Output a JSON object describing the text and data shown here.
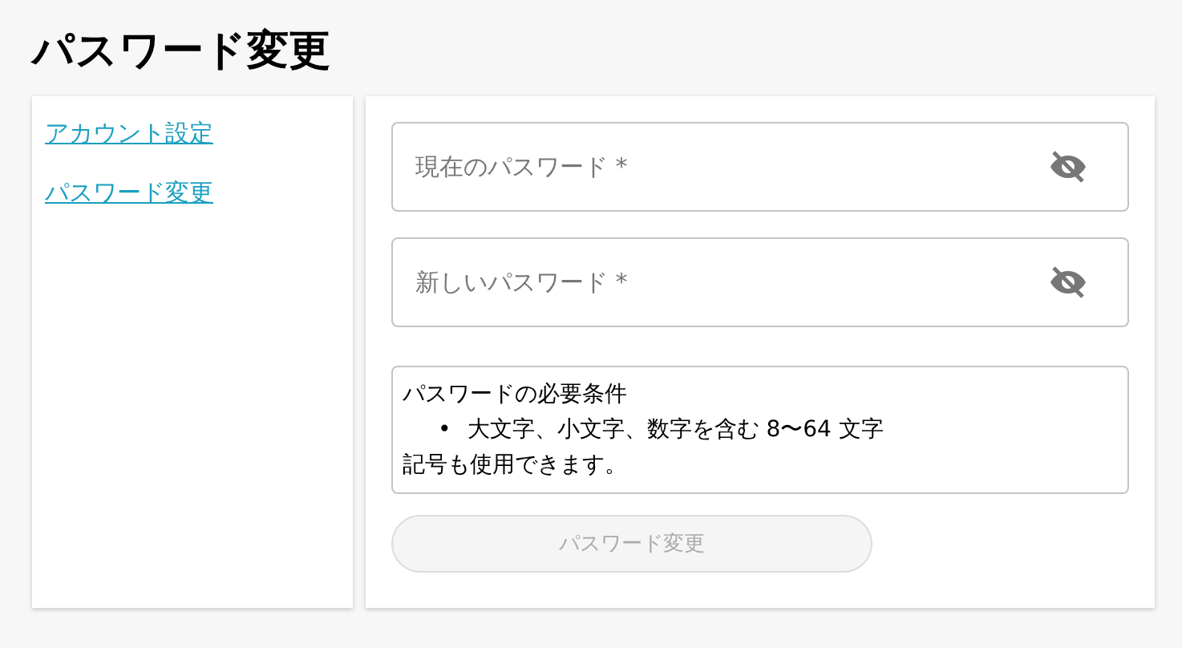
{
  "title": "パスワード変更",
  "sidebar": {
    "items": [
      {
        "label": "アカウント設定"
      },
      {
        "label": "パスワード変更"
      }
    ]
  },
  "fields": [
    {
      "placeholder": "現在のパスワード *",
      "visible": false
    },
    {
      "placeholder": "新しいパスワード *",
      "visible": false
    }
  ],
  "requirements": {
    "heading": "パスワードの必要条件",
    "bullet": "•",
    "items": [
      "大文字、小文字、数字を含む 8〜64 文字"
    ],
    "note": "記号も使用できます。"
  },
  "submit": {
    "label": "パスワード変更",
    "disabled": true
  }
}
